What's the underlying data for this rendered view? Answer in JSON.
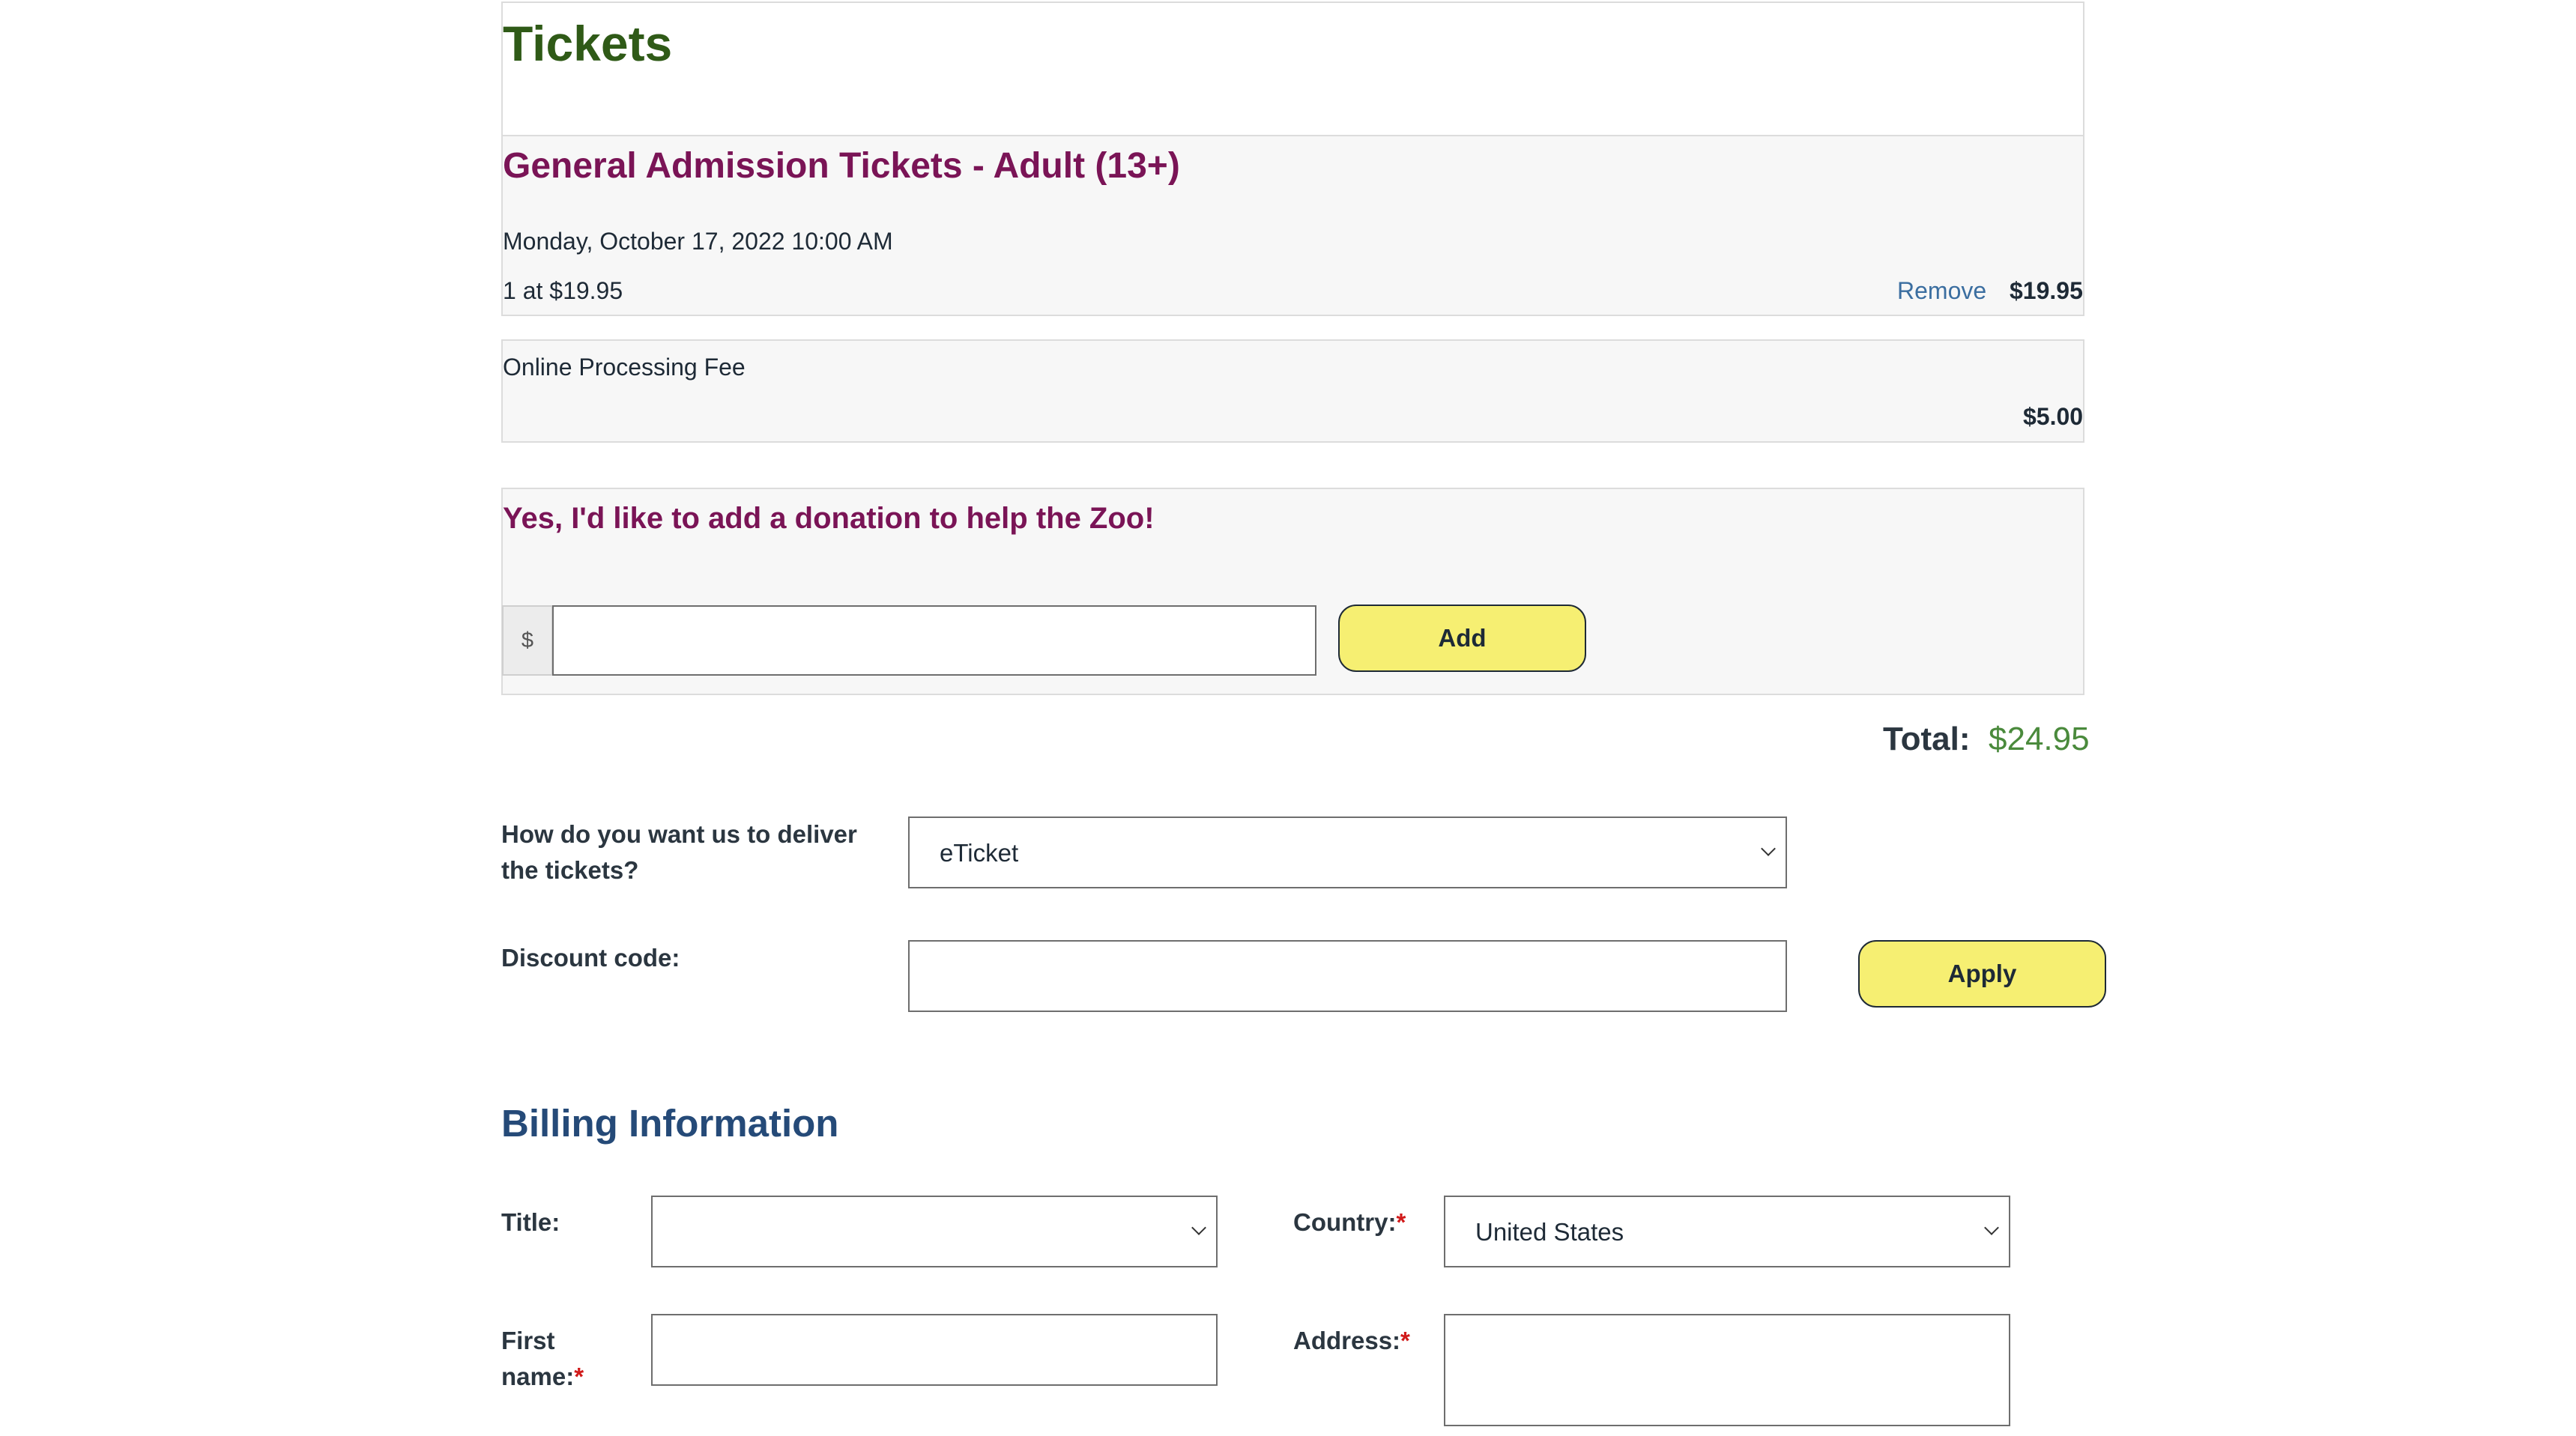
{
  "page_title": "Tickets",
  "cart": {
    "items": [
      {
        "title": "General Admission Tickets - Adult (13+)",
        "date": "Monday, October 17, 2022 10:00 AM",
        "quantity_text": "1 at $19.95",
        "remove_label": "Remove",
        "price": "$19.95"
      }
    ],
    "fee": {
      "label": "Online Processing Fee",
      "price": "$5.00"
    }
  },
  "donation": {
    "title": "Yes, I'd like to add a donation to help the Zoo!",
    "currency_symbol": "$",
    "amount_value": "",
    "add_label": "Add"
  },
  "total": {
    "label": "Total:",
    "value": "$24.95"
  },
  "delivery": {
    "label": "How do you want us to deliver the tickets?",
    "selected": "eTicket"
  },
  "discount": {
    "label": "Discount code:",
    "value": "",
    "apply_label": "Apply"
  },
  "billing": {
    "title": "Billing Information",
    "title_field": {
      "label": "Title:",
      "selected": ""
    },
    "country_field": {
      "label": "Country:",
      "required_mark": "*",
      "selected": "United States"
    },
    "first_name_field": {
      "label": "First name:",
      "required_mark": "*",
      "value": ""
    },
    "address_field": {
      "label": "Address:",
      "required_mark": "*",
      "value": ""
    }
  }
}
